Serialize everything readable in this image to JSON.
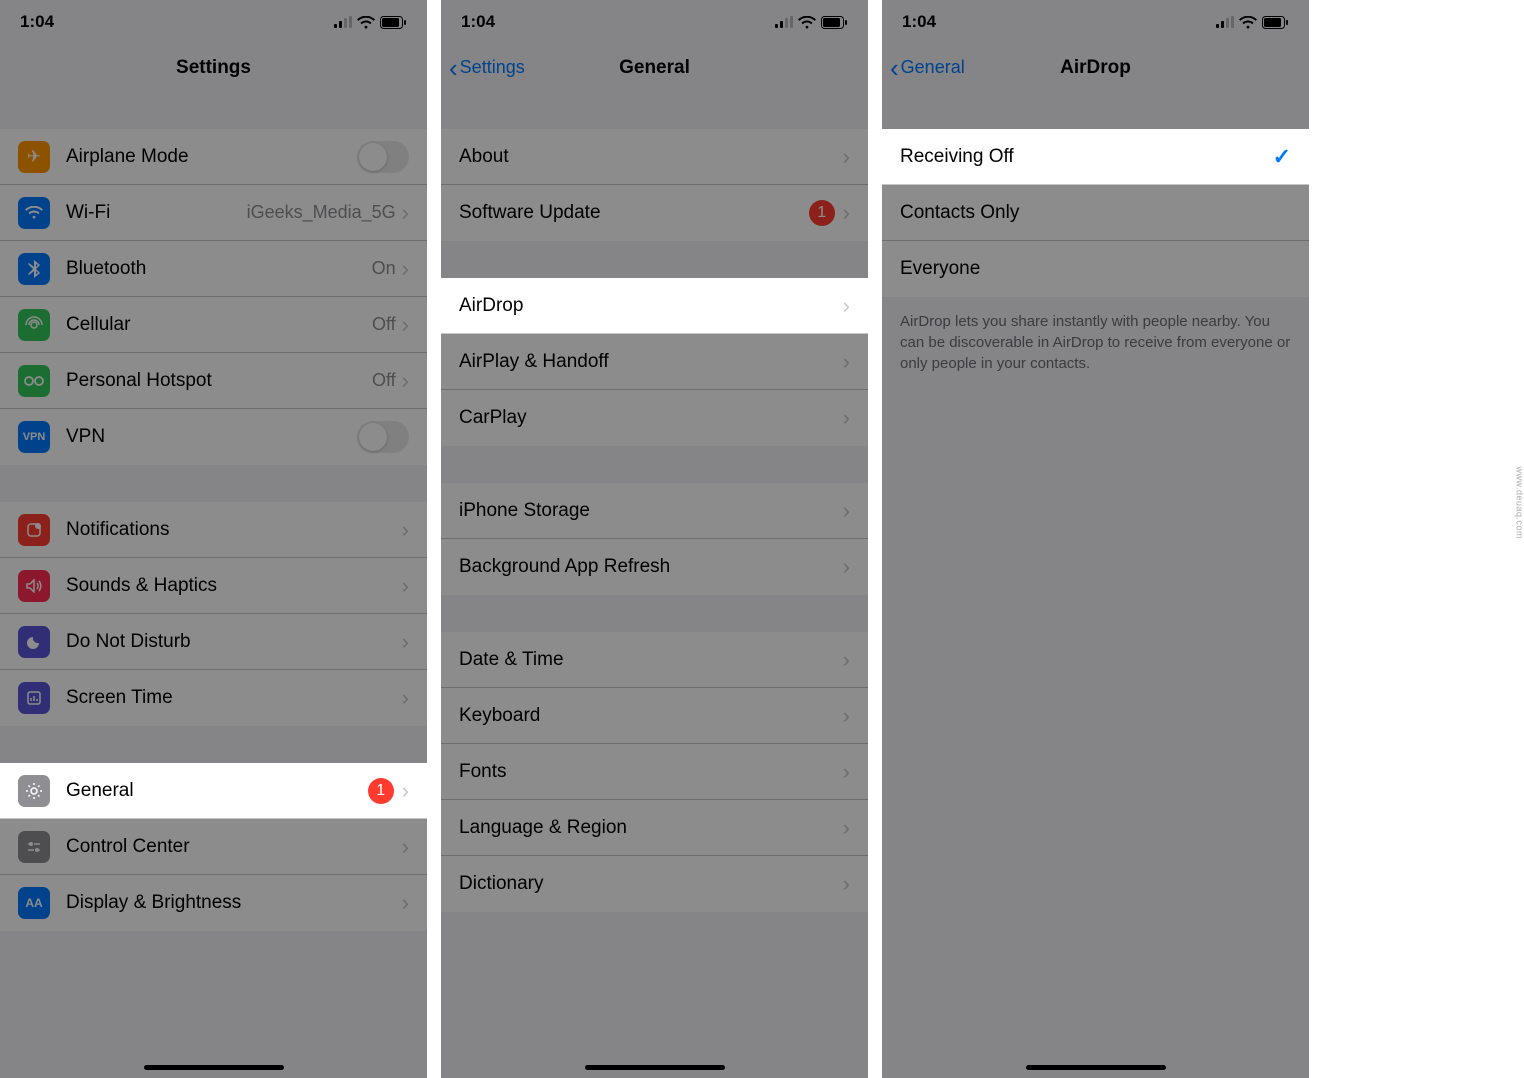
{
  "status": {
    "time": "1:04"
  },
  "screen1": {
    "title": "Settings",
    "rows": {
      "airplane": "Airplane Mode",
      "wifi": "Wi-Fi",
      "wifi_value": "iGeeks_Media_5G",
      "bluetooth": "Bluetooth",
      "bluetooth_value": "On",
      "cellular": "Cellular",
      "cellular_value": "Off",
      "hotspot": "Personal Hotspot",
      "hotspot_value": "Off",
      "vpn": "VPN",
      "notifications": "Notifications",
      "sounds": "Sounds & Haptics",
      "dnd": "Do Not Disturb",
      "screentime": "Screen Time",
      "general": "General",
      "general_badge": "1",
      "control": "Control Center",
      "display": "Display & Brightness"
    }
  },
  "screen2": {
    "back": "Settings",
    "title": "General",
    "rows": {
      "about": "About",
      "software": "Software Update",
      "software_badge": "1",
      "airdrop": "AirDrop",
      "airplay": "AirPlay & Handoff",
      "carplay": "CarPlay",
      "storage": "iPhone Storage",
      "refresh": "Background App Refresh",
      "date": "Date & Time",
      "keyboard": "Keyboard",
      "fonts": "Fonts",
      "language": "Language & Region",
      "dictionary": "Dictionary"
    }
  },
  "screen3": {
    "back": "General",
    "title": "AirDrop",
    "options": {
      "off": "Receiving Off",
      "contacts": "Contacts Only",
      "everyone": "Everyone"
    },
    "footer": "AirDrop lets you share instantly with people nearby. You can be discoverable in AirDrop to receive from everyone or only people in your contacts."
  },
  "watermark": "www.deuaq.com"
}
